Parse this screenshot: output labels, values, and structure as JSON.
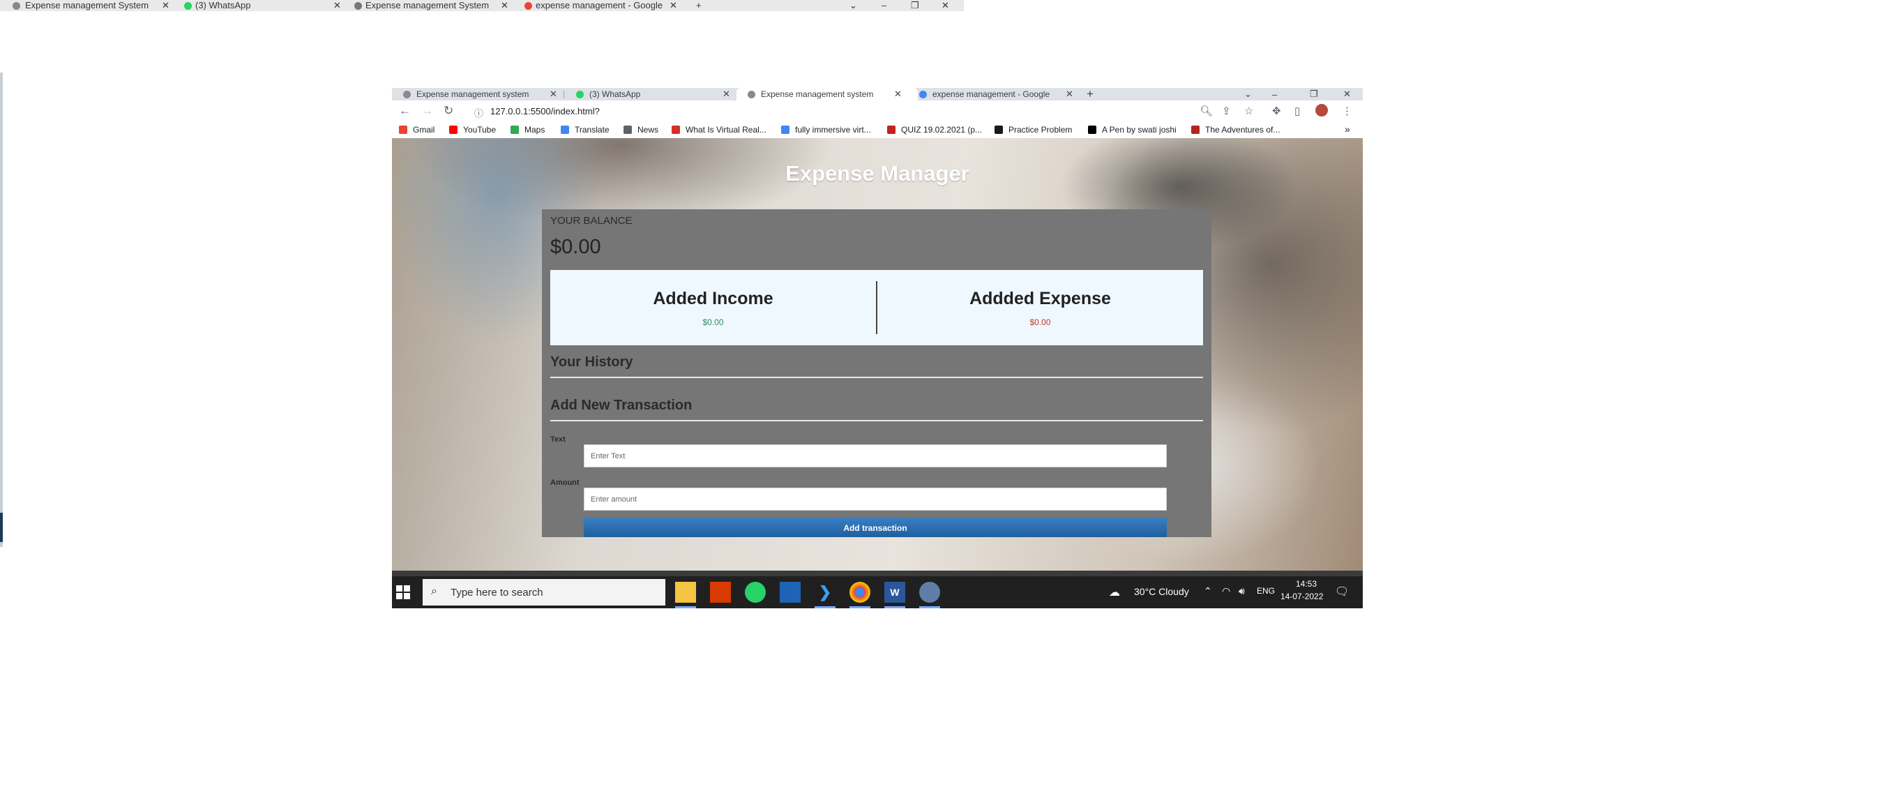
{
  "outer_strip": {
    "tabs": [
      "Expense management System",
      "(3) WhatsApp",
      "Expense management System",
      "expense management - Google"
    ]
  },
  "browser": {
    "tabs": [
      {
        "label": "Expense management system",
        "active": false
      },
      {
        "label": "(3) WhatsApp",
        "active": false
      },
      {
        "label": "Expense management system",
        "active": true
      },
      {
        "label": "expense management - Google",
        "active": false
      }
    ],
    "new_tab_icon": "plus-icon",
    "url": "127.0.0.1:5500/index.html?",
    "bookmarks": [
      {
        "label": "Gmail",
        "icon": "gmail-icon",
        "color": "#ea4335"
      },
      {
        "label": "YouTube",
        "icon": "youtube-icon",
        "color": "#ff0000"
      },
      {
        "label": "Maps",
        "icon": "maps-icon",
        "color": "#34a853"
      },
      {
        "label": "Translate",
        "icon": "translate-icon",
        "color": "#4285f4"
      },
      {
        "label": "News",
        "icon": "news-icon",
        "color": "#5f6368"
      },
      {
        "label": "What Is Virtual Real...",
        "icon": "site-icon",
        "color": "#d93025"
      },
      {
        "label": "fully immersive virt...",
        "icon": "google-icon",
        "color": "#4285f4"
      },
      {
        "label": "QUIZ 19.02.2021 (p...",
        "icon": "quiz-icon",
        "color": "#c5221f"
      },
      {
        "label": "Practice Problem",
        "icon": "site-icon",
        "color": "#1a1a1a"
      },
      {
        "label": "A Pen by swati joshi",
        "icon": "codepen-icon",
        "color": "#000000"
      },
      {
        "label": "The Adventures of...",
        "icon": "book-icon",
        "color": "#b3261e"
      }
    ],
    "more_bookmarks": "»"
  },
  "app": {
    "title": "Expense Manager",
    "balance_label": "YOUR BALANCE",
    "balance_value": "$0.00",
    "income_title": "Added Income",
    "income_value": "$0.00",
    "expense_title": "Addded Expense",
    "expense_value": "$0.00",
    "history_heading": "Your History",
    "new_txn_heading": "Add New Transaction",
    "text_label": "Text",
    "text_placeholder": "Enter Text",
    "amount_label": "Amount",
    "amount_placeholder": "Enter amount",
    "add_button": "Add transaction",
    "colors": {
      "income": "#2e8b57",
      "expense": "#c0392b",
      "container": "#767676",
      "panel": "#f0f8ff",
      "button": "#2a6db0"
    }
  },
  "taskbar": {
    "search_placeholder": "Type here to search",
    "apps": [
      "file-explorer-icon",
      "office-icon",
      "whatsapp-icon",
      "calendar-app-icon",
      "vscode-icon",
      "chrome-icon",
      "word-icon",
      "settings-app-icon"
    ],
    "weather": "30°C  Cloudy",
    "language": "ENG",
    "time": "14:53",
    "date": "14-07-2022"
  }
}
